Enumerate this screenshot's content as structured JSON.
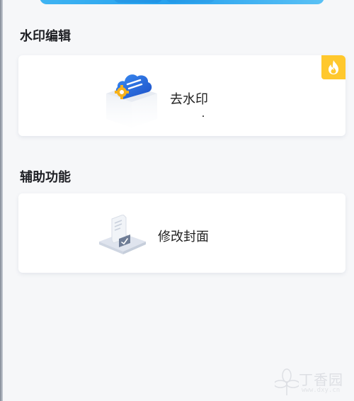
{
  "sections": [
    {
      "title": "水印编辑",
      "card": {
        "label": "去水印",
        "icon": "cloud-stamp-icon",
        "badge_icon": "flame-icon",
        "hot": true
      }
    },
    {
      "title": "辅助功能",
      "card": {
        "label": "修改封面",
        "icon": "document-cover-icon"
      }
    }
  ],
  "watermark": {
    "text": "丁香园",
    "url": "www.dxy.cn"
  },
  "colors": {
    "background": "#f6f7f9",
    "card": "#ffffff",
    "badge": "#ffc82d",
    "banner": "#27a1ee",
    "cloud": "#2f6fe0",
    "gear": "#f6b21c"
  }
}
